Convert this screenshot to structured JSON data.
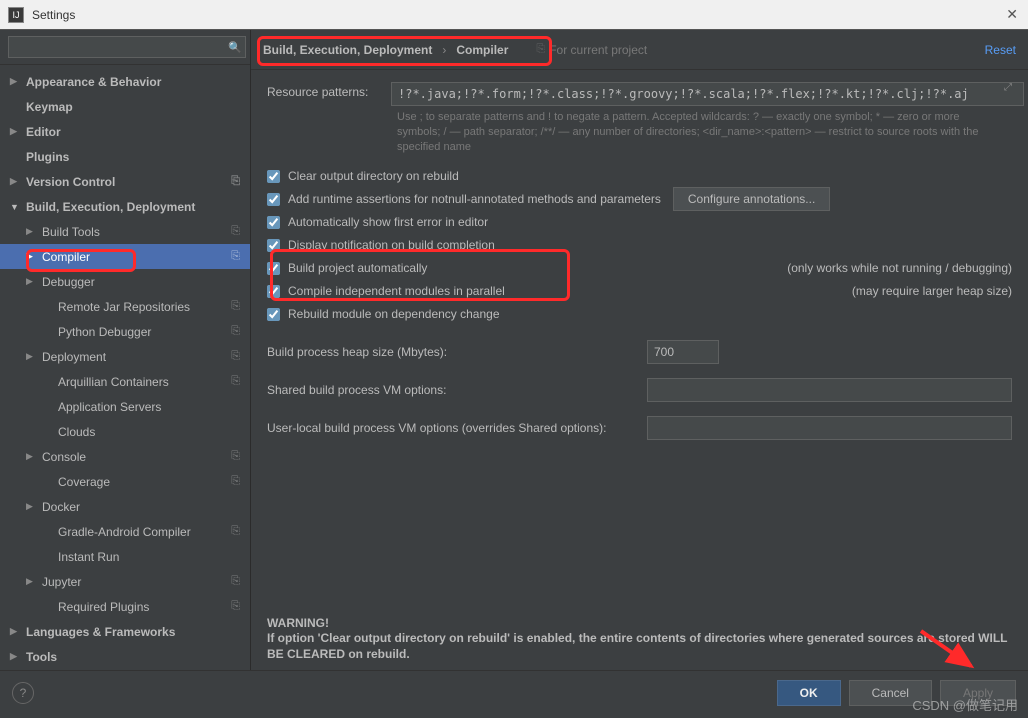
{
  "window": {
    "title": "Settings",
    "close": "✕"
  },
  "search": {
    "placeholder": ""
  },
  "tree": [
    {
      "label": "Appearance & Behavior",
      "arrow": "▶",
      "bold": true,
      "level": 0
    },
    {
      "label": "Keymap",
      "arrow": "",
      "bold": true,
      "level": 0,
      "noarrow": true
    },
    {
      "label": "Editor",
      "arrow": "▶",
      "bold": true,
      "level": 0
    },
    {
      "label": "Plugins",
      "arrow": "",
      "bold": true,
      "level": 0,
      "noarrow": true
    },
    {
      "label": "Version Control",
      "arrow": "▶",
      "bold": true,
      "level": 0,
      "badge": "⎘"
    },
    {
      "label": "Build, Execution, Deployment",
      "arrow": "▼",
      "bold": true,
      "level": 0
    },
    {
      "label": "Build Tools",
      "arrow": "▶",
      "level": 1,
      "badge": "⎘"
    },
    {
      "label": "Compiler",
      "arrow": "▶",
      "level": 1,
      "badge": "⎘",
      "selected": true
    },
    {
      "label": "Debugger",
      "arrow": "▶",
      "level": 1
    },
    {
      "label": "Remote Jar Repositories",
      "arrow": "",
      "level": 2,
      "noarrow": true,
      "badge": "⎘"
    },
    {
      "label": "Python Debugger",
      "arrow": "",
      "level": 2,
      "noarrow": true,
      "badge": "⎘"
    },
    {
      "label": "Deployment",
      "arrow": "▶",
      "level": 1,
      "badge": "⎘"
    },
    {
      "label": "Arquillian Containers",
      "arrow": "",
      "level": 2,
      "noarrow": true,
      "badge": "⎘"
    },
    {
      "label": "Application Servers",
      "arrow": "",
      "level": 2,
      "noarrow": true
    },
    {
      "label": "Clouds",
      "arrow": "",
      "level": 2,
      "noarrow": true
    },
    {
      "label": "Console",
      "arrow": "▶",
      "level": 1,
      "badge": "⎘"
    },
    {
      "label": "Coverage",
      "arrow": "",
      "level": 2,
      "noarrow": true,
      "badge": "⎘"
    },
    {
      "label": "Docker",
      "arrow": "▶",
      "level": 1
    },
    {
      "label": "Gradle-Android Compiler",
      "arrow": "",
      "level": 2,
      "noarrow": true,
      "badge": "⎘"
    },
    {
      "label": "Instant Run",
      "arrow": "",
      "level": 2,
      "noarrow": true
    },
    {
      "label": "Jupyter",
      "arrow": "▶",
      "level": 1,
      "badge": "⎘"
    },
    {
      "label": "Required Plugins",
      "arrow": "",
      "level": 2,
      "noarrow": true,
      "badge": "⎘"
    },
    {
      "label": "Languages & Frameworks",
      "arrow": "▶",
      "bold": true,
      "level": 0
    },
    {
      "label": "Tools",
      "arrow": "▶",
      "bold": true,
      "level": 0
    }
  ],
  "header": {
    "crumb1": "Build, Execution, Deployment",
    "crumb2": "Compiler",
    "chev": "›",
    "note": "For current project",
    "reset": "Reset"
  },
  "form": {
    "resource_label": "Resource patterns:",
    "resource_value": "!?*.java;!?*.form;!?*.class;!?*.groovy;!?*.scala;!?*.flex;!?*.kt;!?*.clj;!?*.aj",
    "hint": "Use ; to separate patterns and ! to negate a pattern. Accepted wildcards: ? — exactly one symbol; * — zero or more symbols; / — path separator; /**/ — any number of directories; <dir_name>:<pattern> — restrict to source roots with the specified name",
    "cb_clear": "Clear output directory on rebuild",
    "cb_assert": "Add runtime assertions for notnull-annotated methods and parameters",
    "btn_cfg": "Configure annotations...",
    "cb_autoerr": "Automatically show first error in editor",
    "cb_notify": "Display notification on build completion",
    "cb_auto": "Build project automatically",
    "cb_auto_note": "(only works while not running / debugging)",
    "cb_parallel": "Compile independent modules in parallel",
    "cb_parallel_note": "(may require larger heap size)",
    "cb_rebuild": "Rebuild module on dependency change",
    "heap_label": "Build process heap size (Mbytes):",
    "heap_value": "700",
    "shared_label": "Shared build process VM options:",
    "local_label": "User-local build process VM options (overrides Shared options):"
  },
  "warning": {
    "title": "WARNING!",
    "body": "If option 'Clear output directory on rebuild' is enabled, the entire contents of directories where generated sources are stored WILL BE CLEARED on rebuild."
  },
  "footer": {
    "ok": "OK",
    "cancel": "Cancel",
    "apply": "Apply"
  },
  "watermark": "CSDN @做笔记用"
}
